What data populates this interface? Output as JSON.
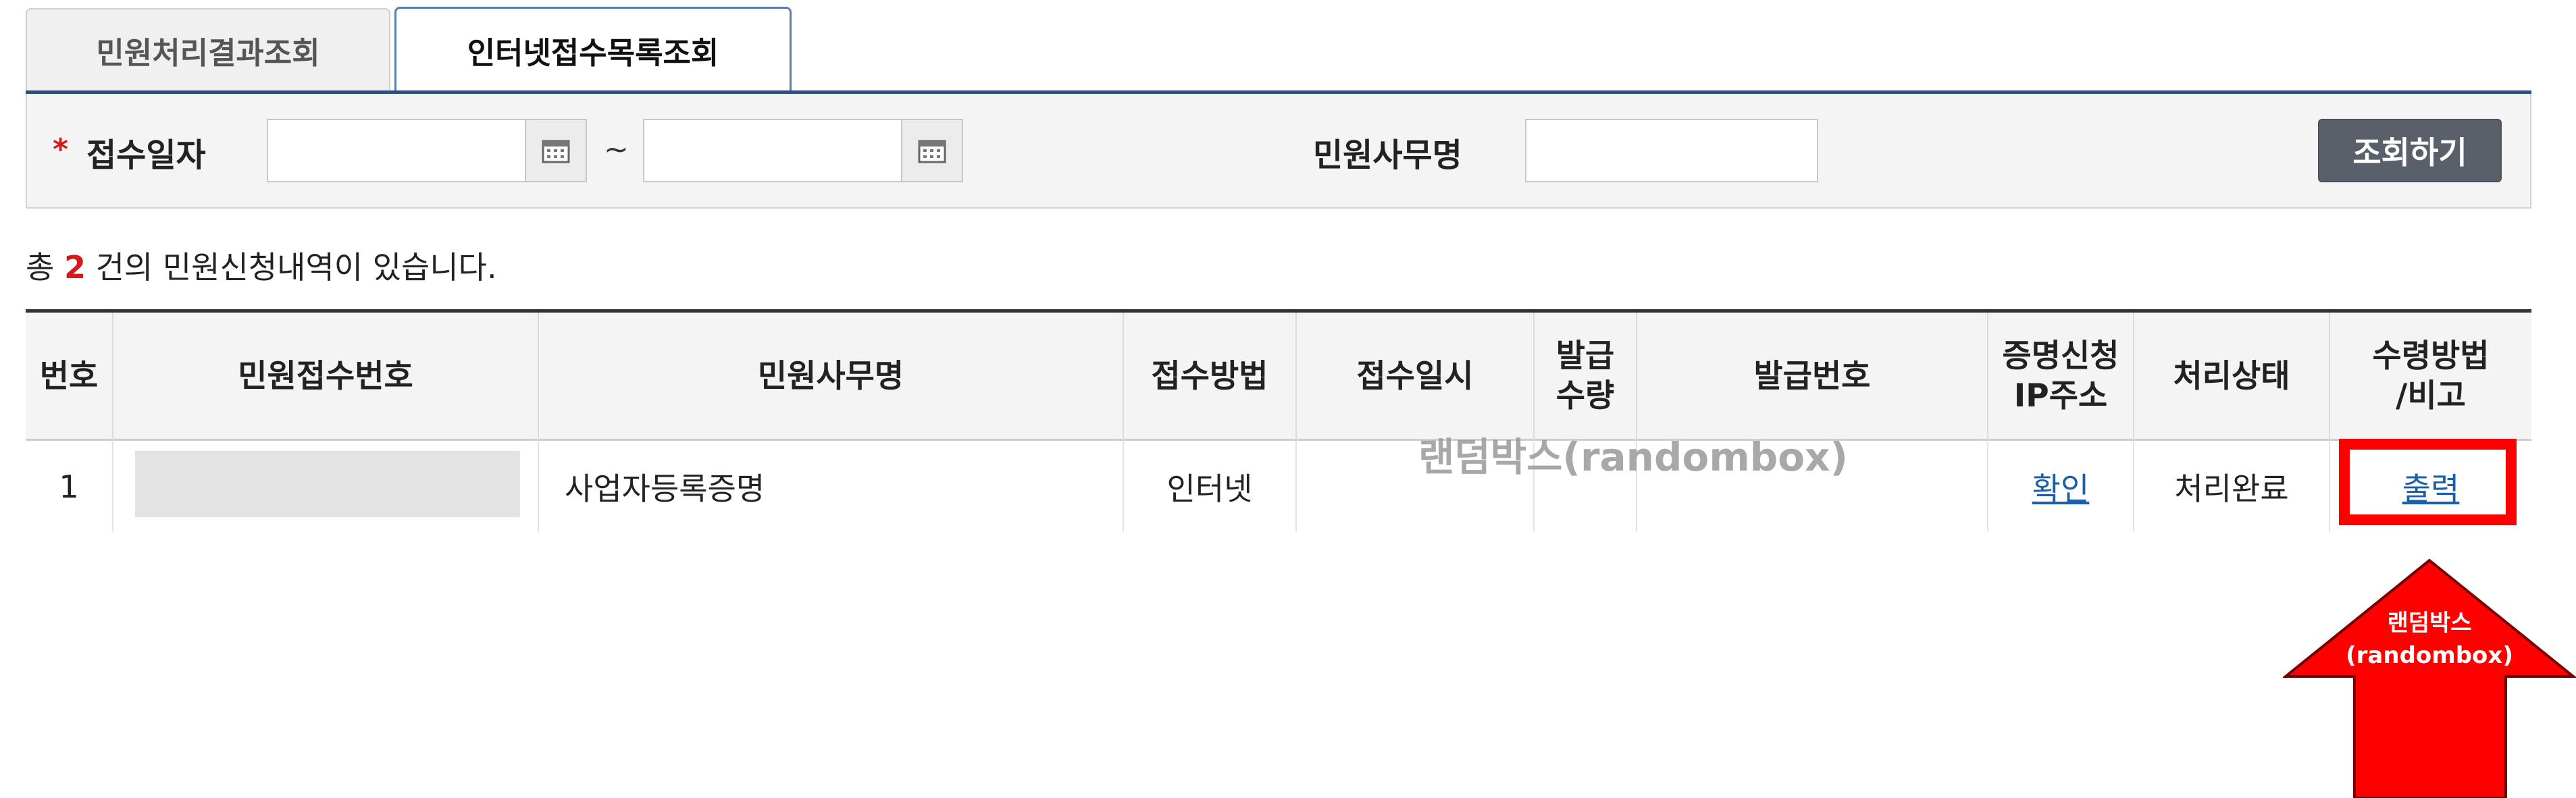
{
  "tabs": [
    {
      "label": "민원처리결과조회",
      "active": false
    },
    {
      "label": "인터넷접수목록조회",
      "active": true
    }
  ],
  "search": {
    "date_label": "접수일자",
    "required_mark": "*",
    "date_from": "",
    "date_to": "",
    "range_separator": "~",
    "office_label": "민원사무명",
    "office_value": "",
    "submit_label": "조회하기"
  },
  "summary": {
    "prefix": "총",
    "count": "2",
    "suffix": "건의 민원신청내역이 있습니다."
  },
  "table": {
    "headers": {
      "no": "번호",
      "receipt_no": "민원접수번호",
      "office_name": "민원사무명",
      "method": "접수방법",
      "datetime": "접수일시",
      "issue_qty_1": "발급",
      "issue_qty_2": "수량",
      "issue_no": "발급번호",
      "ip_1": "증명신청",
      "ip_2": "IP주소",
      "status": "처리상태",
      "receive_1": "수령방법",
      "receive_2": "/비고"
    },
    "rows": [
      {
        "no": "1",
        "office_name": "사업자등록증명",
        "method": "인터넷",
        "datetime": "",
        "issue_qty": "",
        "issue_no": "",
        "ip_action": "확인",
        "status": "처리완료",
        "receive_action": "출력"
      }
    ]
  },
  "watermark": "랜덤박스(randombox)",
  "callout": {
    "line1": "랜덤박스",
    "line2": "(randombox)",
    "color": "#ff0000"
  },
  "colors": {
    "accent_navy": "#2f4d78",
    "link": "#1b5fa8",
    "count_red": "#d21a1a",
    "button_gray": "#5a6069"
  }
}
